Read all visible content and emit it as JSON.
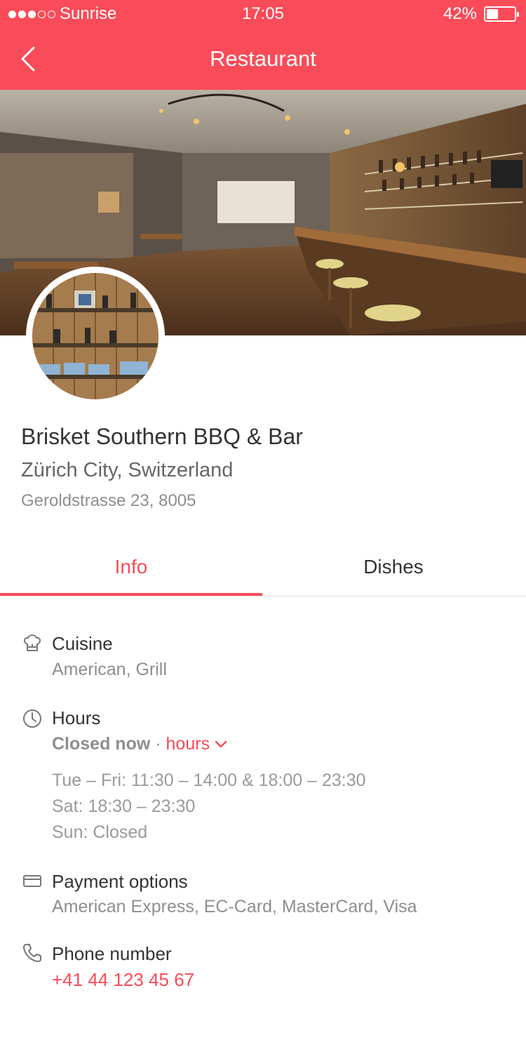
{
  "status_bar": {
    "carrier": "Sunrise",
    "signal_bars": 5,
    "signal_bars_filled": 3,
    "time": "17:05",
    "battery_percent_text": "42%",
    "battery_level": 0.42
  },
  "nav": {
    "title": "Restaurant",
    "back_icon": "chevron-left-icon"
  },
  "restaurant": {
    "name": "Brisket Southern BBQ & Bar",
    "city": "Zürich City, Switzerland",
    "address": "Geroldstrasse 23, 8005"
  },
  "tabs": [
    {
      "label": "Info",
      "active": true
    },
    {
      "label": "Dishes",
      "active": false
    }
  ],
  "info": {
    "cuisine": {
      "icon": "chef-hat-icon",
      "title": "Cuisine",
      "value": "American, Grill"
    },
    "hours": {
      "icon": "clock-icon",
      "title": "Hours",
      "status": "Closed now",
      "separator": "·",
      "toggle_label": "hours",
      "lines": [
        "Tue – Fri: 11:30 – 14:00 & 18:00 – 23:30",
        "Sat: 18:30 – 23:30",
        "Sun: Closed"
      ]
    },
    "payment": {
      "icon": "credit-card-icon",
      "title": "Payment options",
      "value": "American Express, EC-Card, MasterCard, Visa"
    },
    "phone": {
      "icon": "phone-icon",
      "title": "Phone number",
      "value": "+41 44 123 45 67"
    }
  },
  "colors": {
    "accent": "#fa4b58",
    "text_primary": "#333333",
    "text_secondary": "#8e8e8e"
  }
}
